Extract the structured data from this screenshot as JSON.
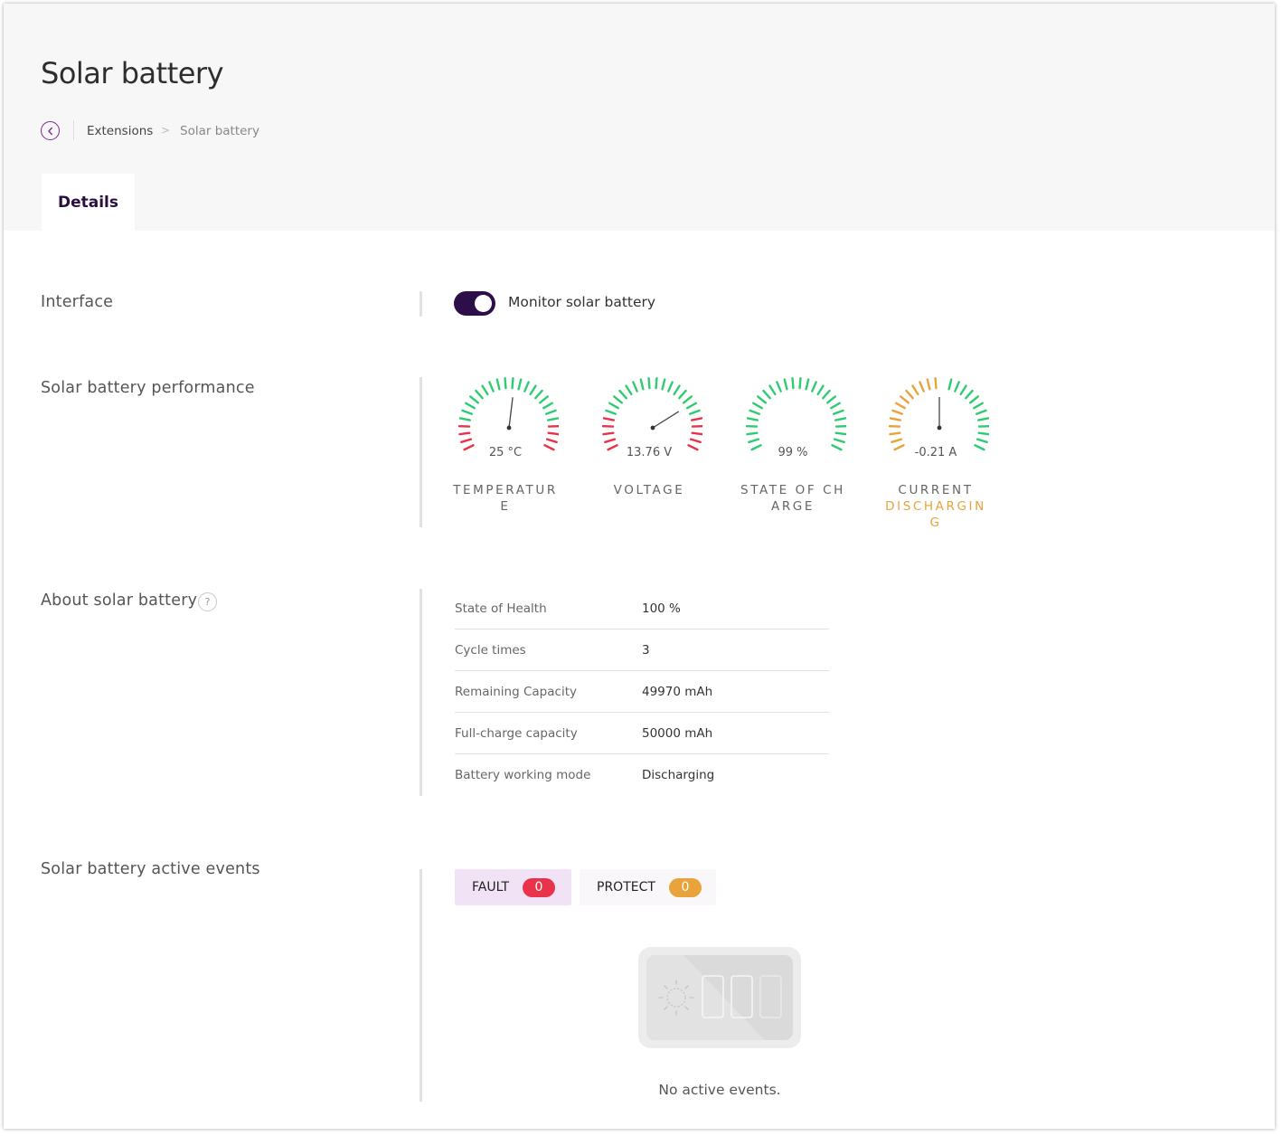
{
  "page": {
    "title": "Solar battery"
  },
  "breadcrumb": {
    "parent": "Extensions",
    "separator": ">",
    "current": "Solar battery"
  },
  "tabs": [
    {
      "label": "Details",
      "active": true
    }
  ],
  "interface": {
    "label": "Interface",
    "toggle_label": "Monitor solar battery",
    "toggle_on": true
  },
  "performance": {
    "label": "Solar battery performance",
    "gauges": [
      {
        "value_text": "25 °C",
        "label": "TEMPERATURE",
        "sub": "",
        "needle_fraction": 0.53,
        "arc_colors": [
          "#e8334a",
          "#e8334a",
          "#e8334a",
          "#e8334a",
          "#2ecc71",
          "#2ecc71",
          "#2ecc71",
          "#2ecc71",
          "#2ecc71",
          "#2ecc71",
          "#2ecc71",
          "#2ecc71",
          "#2ecc71",
          "#2ecc71",
          "#2ecc71",
          "#2ecc71",
          "#2ecc71",
          "#2ecc71",
          "#2ecc71",
          "#2ecc71",
          "#2ecc71",
          "#2ecc71",
          "#e8334a",
          "#e8334a",
          "#e8334a",
          "#e8334a"
        ]
      },
      {
        "value_text": "13.76 V",
        "label": "VOLTAGE",
        "sub": "",
        "needle_fraction": 0.75,
        "arc_colors": [
          "#e8334a",
          "#e8334a",
          "#e8334a",
          "#e8334a",
          "#e8334a",
          "#2ecc71",
          "#2ecc71",
          "#2ecc71",
          "#2ecc71",
          "#2ecc71",
          "#2ecc71",
          "#2ecc71",
          "#2ecc71",
          "#2ecc71",
          "#2ecc71",
          "#2ecc71",
          "#2ecc71",
          "#2ecc71",
          "#2ecc71",
          "#2ecc71",
          "#2ecc71",
          "#e8334a",
          "#e8334a",
          "#e8334a",
          "#e8334a",
          "#e8334a"
        ]
      },
      {
        "value_text": "99 %",
        "label": "STATE OF CHARGE",
        "sub": "",
        "needle_fraction": null,
        "arc_colors": [
          "#2ecc71",
          "#2ecc71",
          "#2ecc71",
          "#2ecc71",
          "#2ecc71",
          "#2ecc71",
          "#2ecc71",
          "#2ecc71",
          "#2ecc71",
          "#2ecc71",
          "#2ecc71",
          "#2ecc71",
          "#2ecc71",
          "#2ecc71",
          "#2ecc71",
          "#2ecc71",
          "#2ecc71",
          "#2ecc71",
          "#2ecc71",
          "#2ecc71",
          "#2ecc71",
          "#2ecc71",
          "#2ecc71",
          "#2ecc71",
          "#2ecc71",
          "#2ecc71"
        ]
      },
      {
        "value_text": "-0.21 A",
        "label": "CURRENT",
        "sub": "DISCHARGING",
        "needle_fraction": 0.5,
        "arc_colors": [
          "#e8a33b",
          "#e8a33b",
          "#e8a33b",
          "#e8a33b",
          "#e8a33b",
          "#e8a33b",
          "#e8a33b",
          "#e8a33b",
          "#e8a33b",
          "#e8a33b",
          "#e8a33b",
          "#e8a33b",
          "#e8a33b",
          "#ffffff",
          "#2ecc71",
          "#2ecc71",
          "#2ecc71",
          "#2ecc71",
          "#2ecc71",
          "#2ecc71",
          "#2ecc71",
          "#2ecc71",
          "#2ecc71",
          "#2ecc71",
          "#2ecc71",
          "#2ecc71"
        ]
      }
    ]
  },
  "about": {
    "label": "About solar battery",
    "help_icon": "question-mark",
    "rows": [
      {
        "key": "State of Health",
        "value": "100 %"
      },
      {
        "key": "Cycle times",
        "value": "3"
      },
      {
        "key": "Remaining Capacity",
        "value": "49970 mAh"
      },
      {
        "key": "Full-charge capacity",
        "value": "50000 mAh"
      },
      {
        "key": "Battery working mode",
        "value": "Discharging"
      }
    ]
  },
  "events": {
    "label": "Solar battery active events",
    "filters": [
      {
        "label": "FAULT",
        "count": "0",
        "color": "#e8334a"
      },
      {
        "label": "PROTECT",
        "count": "0",
        "color": "#e8a33b"
      }
    ],
    "empty_text": "No active events."
  },
  "colors": {
    "accent": "#2c0f48",
    "back": "#7b2b8f",
    "ok": "#2ecc71",
    "alarm": "#e8334a",
    "warn": "#e8a33b"
  }
}
